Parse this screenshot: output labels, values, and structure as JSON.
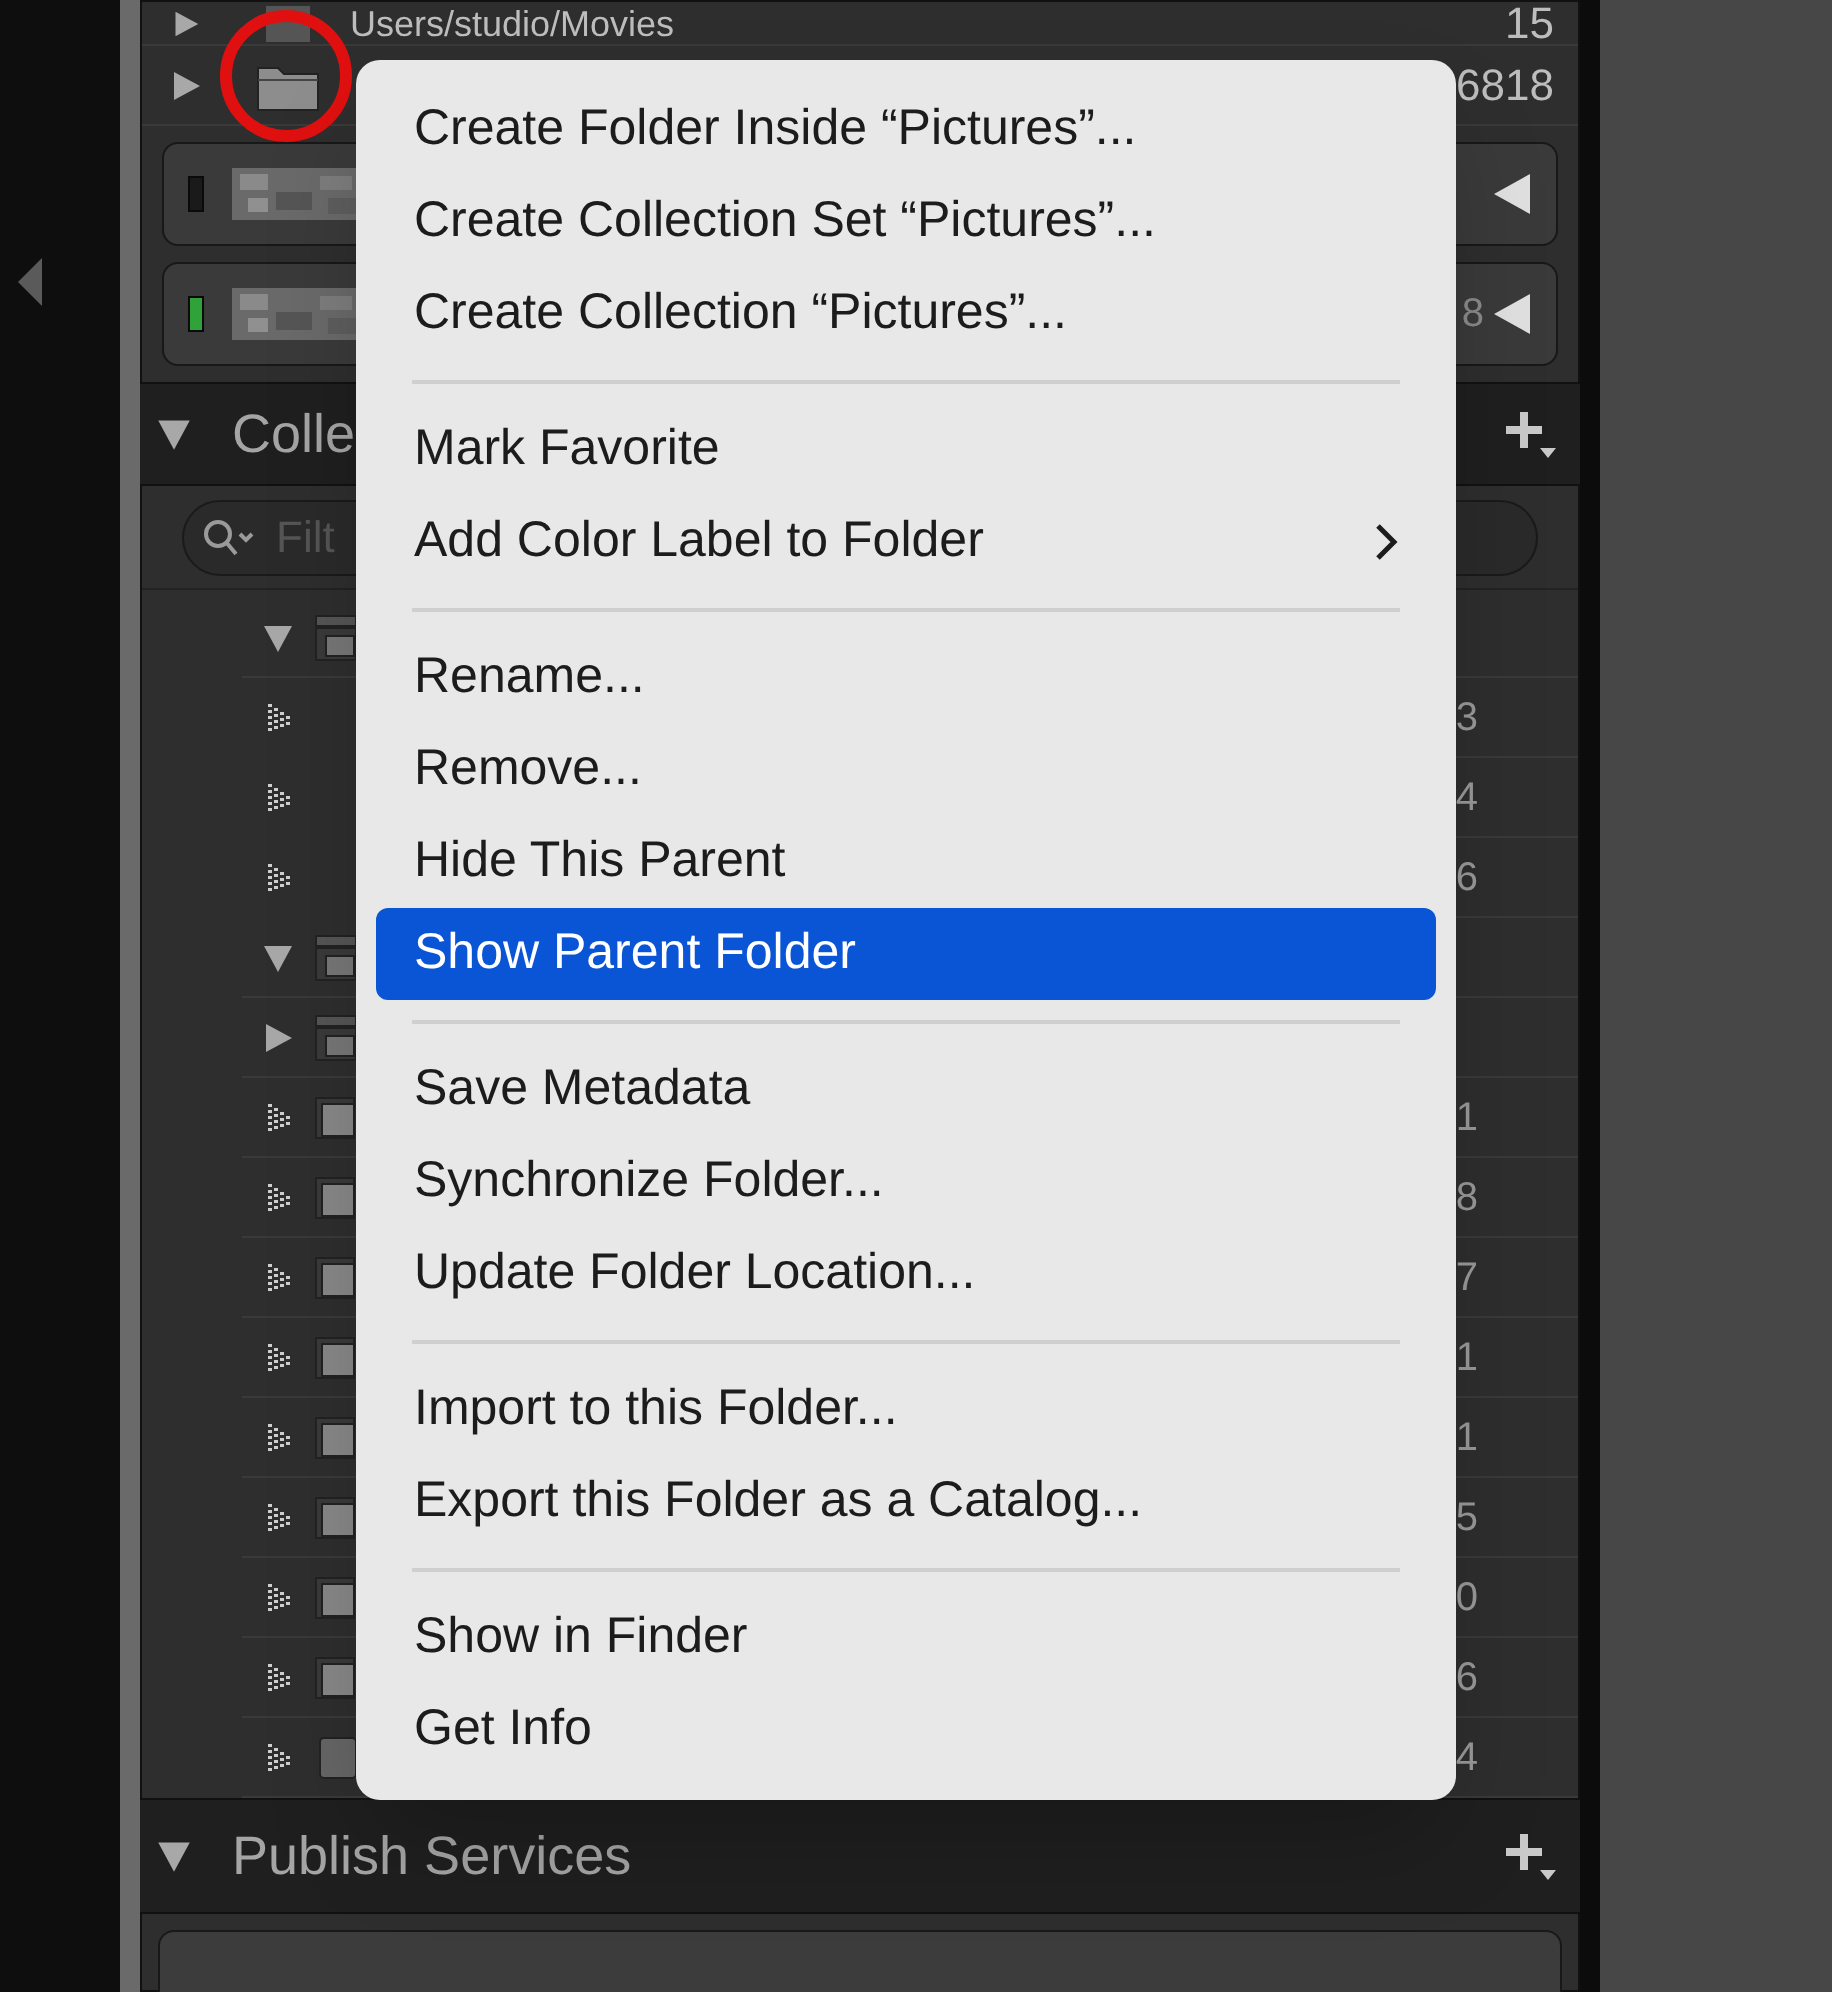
{
  "folders": [
    {
      "name": "Users/studio/Movies",
      "count": "15",
      "expanded": false
    },
    {
      "count": "6818",
      "expanded": false
    }
  ],
  "volumes": [
    {
      "color": "#1a1a1a"
    },
    {
      "color": "#2fa33a",
      "count": "8"
    }
  ],
  "collections": {
    "title": "Colle",
    "expanded": true,
    "filter_placeholder": "Filt",
    "items": [
      {
        "kind": "set",
        "expanded": true,
        "children": [
          {
            "kind": "collection",
            "count": "3"
          },
          {
            "kind": "collection",
            "count": "4"
          },
          {
            "kind": "collection",
            "count": "6"
          }
        ]
      },
      {
        "kind": "set",
        "expanded": true
      },
      {
        "kind": "set",
        "expanded": false
      },
      {
        "kind": "collection",
        "count": "1"
      },
      {
        "kind": "collection",
        "count": "8"
      },
      {
        "kind": "collection",
        "count": "7"
      },
      {
        "kind": "collection",
        "count": "1"
      },
      {
        "kind": "collection",
        "count": "1"
      },
      {
        "kind": "collection",
        "count": "5"
      },
      {
        "kind": "collection",
        "count": "0"
      },
      {
        "kind": "collection",
        "count": "6"
      },
      {
        "kind": "plain",
        "count": "4"
      }
    ]
  },
  "publish_services": {
    "title": "Publish Services",
    "expanded": true
  },
  "context_menu": {
    "groups": [
      [
        {
          "label": "Create Folder Inside “Pictures”...",
          "selected": false
        },
        {
          "label": "Create Collection Set “Pictures”...",
          "selected": false
        },
        {
          "label": "Create Collection “Pictures”...",
          "selected": false
        }
      ],
      [
        {
          "label": "Mark Favorite",
          "selected": false
        },
        {
          "label": "Add Color Label to Folder",
          "selected": false,
          "submenu": true
        }
      ],
      [
        {
          "label": "Rename...",
          "selected": false
        },
        {
          "label": "Remove...",
          "selected": false
        },
        {
          "label": "Hide This Parent",
          "selected": false
        },
        {
          "label": "Show Parent Folder",
          "selected": true
        }
      ],
      [
        {
          "label": "Save Metadata",
          "selected": false
        },
        {
          "label": "Synchronize Folder...",
          "selected": false
        },
        {
          "label": "Update Folder Location...",
          "selected": false
        }
      ],
      [
        {
          "label": "Import to this Folder...",
          "selected": false
        },
        {
          "label": "Export this Folder as a Catalog...",
          "selected": false
        }
      ],
      [
        {
          "label": "Show in Finder",
          "selected": false
        },
        {
          "label": "Get Info",
          "selected": false
        }
      ]
    ]
  }
}
